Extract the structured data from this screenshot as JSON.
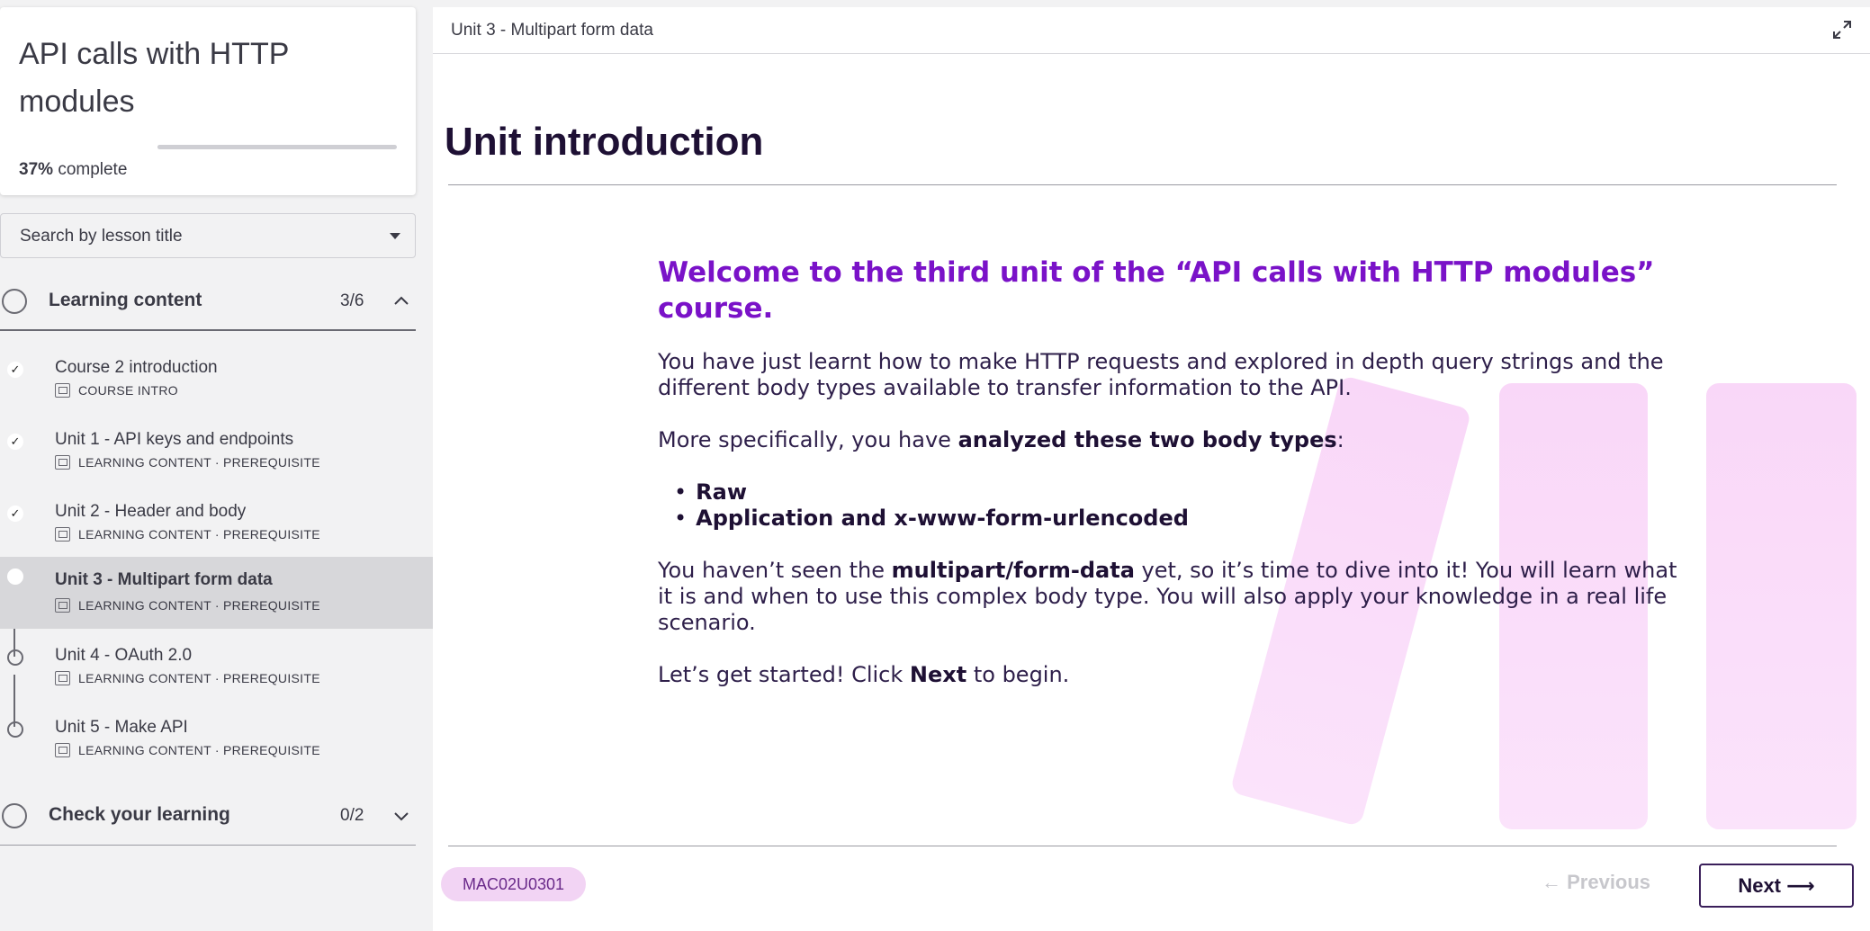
{
  "course": {
    "title": "API calls with HTTP modules",
    "progress_percent": 37,
    "progress_percent_label": "37%",
    "progress_suffix": "complete"
  },
  "search": {
    "placeholder": "Search by lesson title"
  },
  "sections": [
    {
      "title": "Learning content",
      "count": "3/6",
      "expanded": true,
      "lessons": [
        {
          "title": "Course 2 introduction",
          "meta": "COURSE INTRO",
          "status": "done"
        },
        {
          "title": "Unit 1 - API keys and endpoints",
          "meta": "LEARNING CONTENT · PREREQUISITE",
          "status": "done"
        },
        {
          "title": "Unit 2 - Header and body",
          "meta": "LEARNING CONTENT · PREREQUISITE",
          "status": "done"
        },
        {
          "title": "Unit 3 - Multipart form data",
          "meta": "LEARNING CONTENT · PREREQUISITE",
          "status": "current"
        },
        {
          "title": "Unit 4 - OAuth 2.0",
          "meta": "LEARNING CONTENT · PREREQUISITE",
          "status": "open"
        },
        {
          "title": "Unit 5 - Make API",
          "meta": "LEARNING CONTENT · PREREQUISITE",
          "status": "open"
        }
      ]
    },
    {
      "title": "Check your learning",
      "count": "0/2",
      "expanded": false
    }
  ],
  "main": {
    "topbar_title": "Unit 3 - Multipart form data",
    "heading": "Unit introduction",
    "welcome": "Welcome to the third unit of the “API calls with HTTP modules” course.",
    "p1": "You have just learnt how to make HTTP requests and explored in depth query strings and the different body types available to transfer information to the API.",
    "p2_pre": "More specifically, you have ",
    "p2_bold": "analyzed these two body types",
    "p2_post": ":",
    "body_types": [
      "Raw",
      "Application and x-www-form-urlencoded"
    ],
    "p3_pre": "You haven’t seen the ",
    "p3_bold": "multipart/form-data",
    "p3_post": " yet, so it’s time to dive into it! You will learn what it is and when to use this complex body type. You will also apply your knowledge in a real life scenario.",
    "p4_pre": "Let’s get started! Click ",
    "p4_bold": "Next",
    "p4_post": " to begin.",
    "code": "MAC02U0301",
    "prev_label": "← Previous",
    "next_label": "Next ⟶"
  },
  "colors": {
    "accent": "#7a12c8",
    "heading": "#1e1034",
    "pill": "#f2d4f4",
    "deco": "#f9d7f8"
  }
}
